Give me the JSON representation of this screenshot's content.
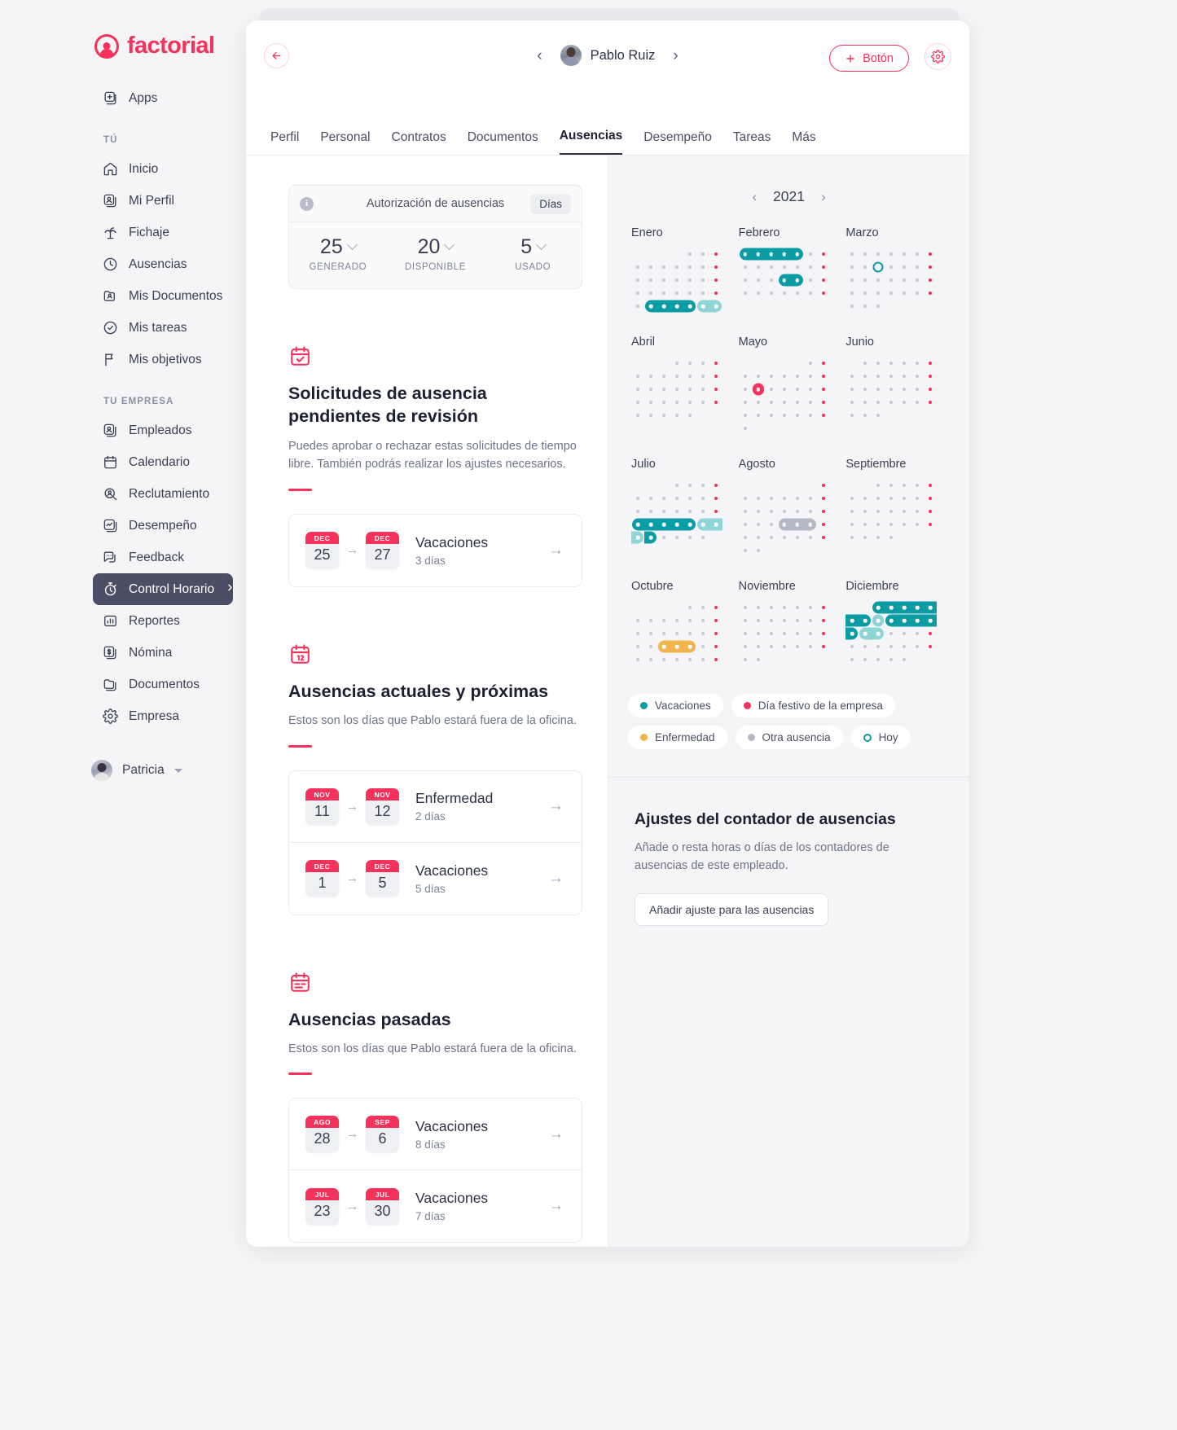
{
  "brand": {
    "name": "factorial"
  },
  "sidebar": {
    "apps_label": "Apps",
    "section_you": "TÚ",
    "section_company": "TU EMPRESA",
    "you_items": [
      {
        "label": "Inicio",
        "icon": "home-icon"
      },
      {
        "label": "Mi Perfil",
        "icon": "user-card-icon"
      },
      {
        "label": "Fichaje",
        "icon": "palm-tree-icon"
      },
      {
        "label": "Ausencias",
        "icon": "clock-icon"
      },
      {
        "label": "Mis Documentos",
        "icon": "folder-user-icon"
      },
      {
        "label": "Mis tareas",
        "icon": "check-circle-icon"
      },
      {
        "label": "Mis objetivos",
        "icon": "flag-icon"
      }
    ],
    "company_items": [
      {
        "label": "Empleados",
        "icon": "users-icon",
        "active": false
      },
      {
        "label": "Calendario",
        "icon": "calendar-icon",
        "active": false
      },
      {
        "label": "Reclutamiento",
        "icon": "search-user-icon",
        "active": false
      },
      {
        "label": "Desempeño",
        "icon": "performance-icon",
        "active": false
      },
      {
        "label": "Feedback",
        "icon": "chat-icon",
        "active": false
      },
      {
        "label": "Control Horario",
        "icon": "stopwatch-icon",
        "active": true
      },
      {
        "label": "Reportes",
        "icon": "bar-chart-icon",
        "active": false
      },
      {
        "label": "Nómina",
        "icon": "money-icon",
        "active": false
      },
      {
        "label": "Documentos",
        "icon": "folder-icon",
        "active": false
      },
      {
        "label": "Empresa",
        "icon": "gear-icon",
        "active": false
      }
    ],
    "user": {
      "name": "Patricia"
    }
  },
  "topbar": {
    "employee_name": "Pablo Ruiz",
    "prev_label": "‹",
    "next_label": "›",
    "button_label": "Botón",
    "plus_label": "+"
  },
  "tabs": [
    {
      "label": "Perfil",
      "active": false
    },
    {
      "label": "Personal",
      "active": false
    },
    {
      "label": "Contratos",
      "active": false
    },
    {
      "label": "Documentos",
      "active": false
    },
    {
      "label": "Ausencias",
      "active": true
    },
    {
      "label": "Desempeño",
      "active": false
    },
    {
      "label": "Tareas",
      "active": false
    },
    {
      "label": "Más",
      "active": false
    }
  ],
  "balance": {
    "title": "Autorización de ausencias",
    "unit_badge": "Días",
    "stats": [
      {
        "value": "25",
        "label": "GENERADO"
      },
      {
        "value": "20",
        "label": "DISPONIBLE"
      },
      {
        "value": "5",
        "label": "USADO"
      }
    ]
  },
  "sections": [
    {
      "icon": "calendar-check-icon",
      "title": "Solicitudes de ausencia pendientes de revisión",
      "desc": "Puedes aprobar o rechazar estas solicitudes de tiempo libre. También podrás realizar los ajustes necesarios.",
      "rows": [
        {
          "from_month": "DEC",
          "from_day": "25",
          "to_month": "DEC",
          "to_day": "27",
          "name": "Vacaciones",
          "duration": "3 días"
        }
      ]
    },
    {
      "icon": "calendar-12-icon",
      "title": "Ausencias actuales y próximas",
      "desc": "Estos son los días que Pablo estará fuera de la oficina.",
      "rows": [
        {
          "from_month": "NOV",
          "from_day": "11",
          "to_month": "NOV",
          "to_day": "12",
          "name": "Enfermedad",
          "duration": "2 días"
        },
        {
          "from_month": "DEC",
          "from_day": "1",
          "to_month": "DEC",
          "to_day": "5",
          "name": "Vacaciones",
          "duration": "5 días"
        }
      ]
    },
    {
      "icon": "calendar-lines-icon",
      "title": "Ausencias pasadas",
      "desc": "Estos son los días que Pablo estará fuera de la oficina.",
      "rows": [
        {
          "from_month": "AGO",
          "from_day": "28",
          "to_month": "SEP",
          "to_day": "6",
          "name": "Vacaciones",
          "duration": "8 días"
        },
        {
          "from_month": "JUL",
          "from_day": "23",
          "to_month": "JUL",
          "to_day": "30",
          "name": "Vacaciones",
          "duration": "7 días"
        }
      ]
    }
  ],
  "calendar": {
    "year": "2021",
    "prev_label": "‹",
    "next_label": "›",
    "colors": {
      "vacation": "#0b9ba3",
      "vacation_light": "#8fd5d8",
      "holiday": "#f5325b",
      "sick": "#f2b54e",
      "other": "#b5b9c6",
      "today_ring": "#0b9ba3",
      "normal_day": "#c6c9d4"
    },
    "months": [
      {
        "name": "Enero",
        "lead": 4,
        "days": 31
      },
      {
        "name": "Febrero",
        "lead": 0,
        "days": 28
      },
      {
        "name": "Marzo",
        "lead": 0,
        "days": 31
      },
      {
        "name": "Abril",
        "lead": 3,
        "days": 30
      },
      {
        "name": "Mayo",
        "lead": 5,
        "days": 31
      },
      {
        "name": "Junio",
        "lead": 1,
        "days": 30
      },
      {
        "name": "Julio",
        "lead": 3,
        "days": 31
      },
      {
        "name": "Agosto",
        "lead": 6,
        "days": 31
      },
      {
        "name": "Septiembre",
        "lead": 2,
        "days": 30
      },
      {
        "name": "Octubre",
        "lead": 4,
        "days": 31
      },
      {
        "name": "Noviembre",
        "lead": 0,
        "days": 30
      },
      {
        "name": "Diciembre",
        "lead": 2,
        "days": 31
      }
    ],
    "legend": [
      {
        "label": "Vacaciones",
        "color": "#0b9ba3",
        "style": "dot"
      },
      {
        "label": "Día festivo de la empresa",
        "color": "#f5325b",
        "style": "dot"
      },
      {
        "label": "Enfermedad",
        "color": "#f2b54e",
        "style": "dot"
      },
      {
        "label": "Otra ausencia",
        "color": "#b5b9c6",
        "style": "dot"
      },
      {
        "label": "Hoy",
        "color": "#0b9ba3",
        "style": "ring"
      }
    ]
  },
  "adjustments": {
    "title": "Ajustes del contador de ausencias",
    "desc": "Añade o resta horas o días de los contadores de ausencias de este empleado.",
    "button": "Añadir ajuste para las ausencias"
  }
}
